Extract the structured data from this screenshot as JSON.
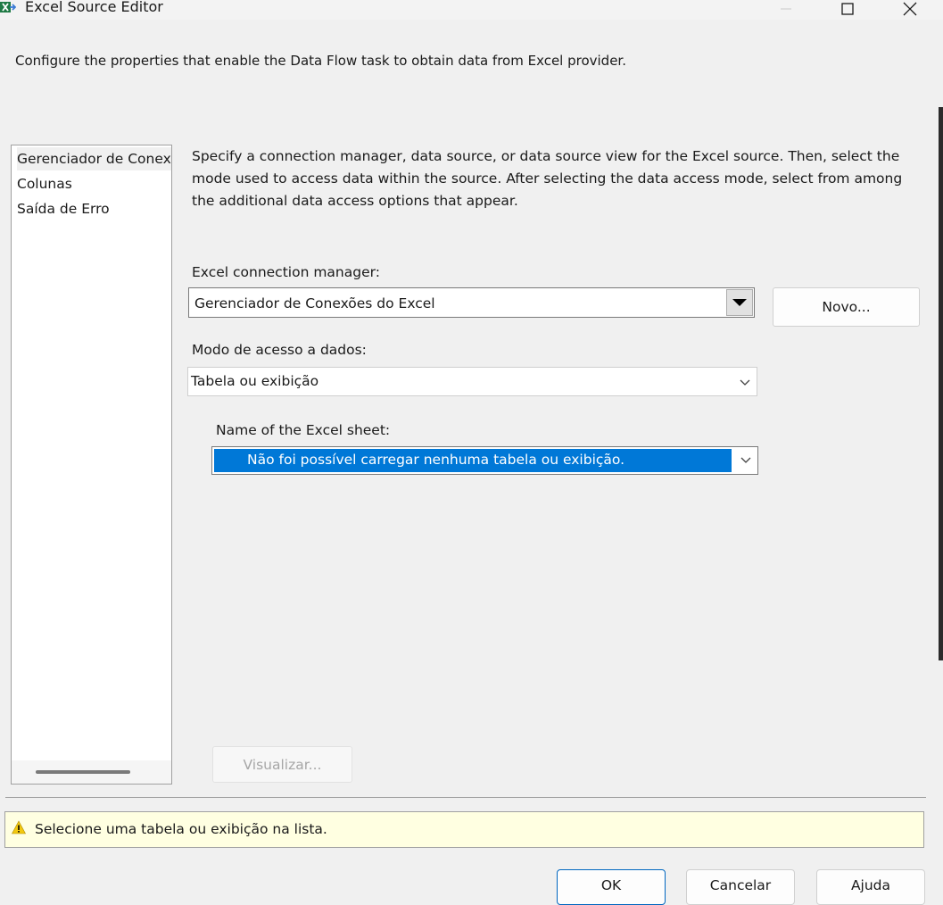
{
  "window": {
    "title": "Excel Source Editor",
    "icon": "excel-source-icon",
    "controls": [
      "minimize-icon",
      "maximize-icon",
      "close-icon"
    ]
  },
  "description": "Configure the properties that enable the Data Flow task to obtain data from Excel provider.",
  "nav": {
    "items": [
      {
        "label": "Gerenciador de Conexões",
        "selected": true
      },
      {
        "label": "Colunas",
        "selected": false
      },
      {
        "label": "Saída de Erro",
        "selected": false
      }
    ]
  },
  "instructions": "Specify a connection manager, data source, or data source view for the Excel source. Then, select the mode used to access data within the source. After selecting the data access mode, select from among the additional data access options that appear.",
  "connection": {
    "label": "Excel connection manager:",
    "value": "Gerenciador de Conexões do Excel",
    "new_button": "Novo..."
  },
  "access_mode": {
    "label": "Modo de acesso a dados:",
    "value": "Tabela ou exibição"
  },
  "sheet": {
    "label": "Name of the Excel sheet:",
    "value": "Não foi possível carregar nenhuma tabela ou exibição."
  },
  "preview_button": "Visualizar...",
  "status": {
    "message": "Selecione uma tabela ou exibição na lista.",
    "icon": "warning-icon"
  },
  "footer_buttons": [
    "OK",
    "Cancelar",
    "Ajuda"
  ],
  "colors": {
    "selection": "#0078d7",
    "status_background": "#ffffe1",
    "warning": "#f2c80f"
  }
}
